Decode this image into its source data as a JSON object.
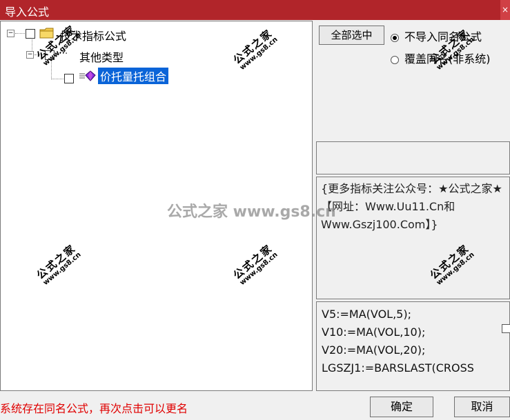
{
  "window": {
    "title": "导入公式",
    "close_symbol": "×"
  },
  "tree": {
    "root": {
      "label": "技术指标公式",
      "expander": "−"
    },
    "group": {
      "label": "其他类型",
      "expander": "−"
    },
    "item": {
      "label": "价托量托组合"
    }
  },
  "options": {
    "select_all_label": "全部选中",
    "radio_no_import_label": "不导入同名公式",
    "radio_overwrite_label": "覆盖同名(非系统)",
    "radio_selected": "no_import"
  },
  "info": {
    "text": "{更多指标关注公众号：★公式之家★【网址：Www.Uu11.Cn和Www.Gszj100.Com】}"
  },
  "code": {
    "lines": [
      "V5:=MA(VOL,5);",
      "V10:=MA(VOL,10);",
      "V20:=MA(VOL,20);",
      "LGSZJ1:=BARSLAST(CROSS"
    ]
  },
  "footer": {
    "status_message": "系统存在同名公式，再次点击可以更名",
    "ok_label": "确定",
    "cancel_label": "取消"
  },
  "watermark": {
    "center_text": "公式之家 www.gs8.cn",
    "stamp_line1": "公式之家",
    "stamp_line2": "www.gs8.cn"
  },
  "colors": {
    "title_bar": "#b1252a",
    "selection": "#0a64d8",
    "status_text": "#e00000"
  }
}
